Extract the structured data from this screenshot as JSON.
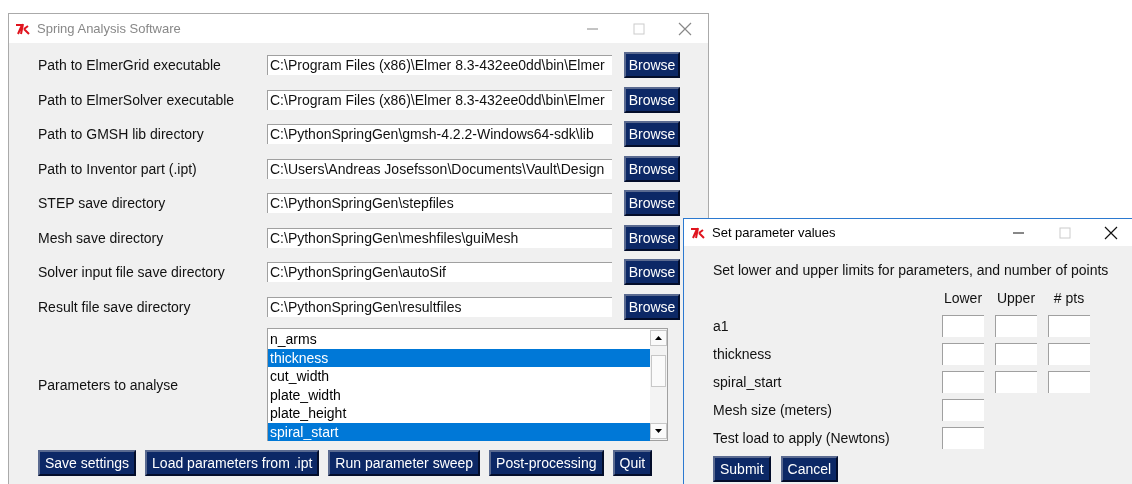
{
  "main_window": {
    "title": "Spring Analysis Software",
    "paths": [
      {
        "label": "Path to ElmerGrid executable",
        "value": "C:\\Program Files (x86)\\Elmer 8.3-432ee0dd\\bin\\Elmer",
        "button": "Browse"
      },
      {
        "label": "Path to ElmerSolver executable",
        "value": "C:\\Program Files (x86)\\Elmer 8.3-432ee0dd\\bin\\Elmer",
        "button": "Browse"
      },
      {
        "label": "Path to GMSH lib directory",
        "value": "C:\\PythonSpringGen\\gmsh-4.2.2-Windows64-sdk\\lib",
        "button": "Browse"
      },
      {
        "label": "Path to Inventor part (.ipt)",
        "value": "C:\\Users\\Andreas Josefsson\\Documents\\Vault\\Design",
        "button": "Browse"
      },
      {
        "label": "STEP save directory",
        "value": "C:\\PythonSpringGen\\stepfiles",
        "button": "Browse"
      },
      {
        "label": "Mesh save directory",
        "value": "C:\\PythonSpringGen\\meshfiles\\guiMesh",
        "button": "Browse"
      },
      {
        "label": "Solver input file save directory",
        "value": "C:\\PythonSpringGen\\autoSif",
        "button": "Browse"
      },
      {
        "label": "Result file save directory",
        "value": "C:\\PythonSpringGen\\resultfiles",
        "button": "Browse"
      }
    ],
    "parameters": {
      "label": "Parameters to analyse",
      "items": [
        {
          "label": "n_arms",
          "selected": false
        },
        {
          "label": "thickness",
          "selected": true
        },
        {
          "label": "cut_width",
          "selected": false
        },
        {
          "label": "plate_width",
          "selected": false
        },
        {
          "label": "plate_height",
          "selected": false
        },
        {
          "label": "spiral_start",
          "selected": true
        }
      ]
    },
    "buttons": [
      "Save settings",
      "Load parameters from .ipt",
      "Run parameter sweep",
      "Post-processing",
      "Quit"
    ]
  },
  "dialog": {
    "title": "Set parameter values",
    "instruction": "Set lower and upper limits for parameters, and number of points",
    "columns": [
      "Lower",
      "Upper",
      "# pts"
    ],
    "rows": [
      {
        "label": "a1",
        "kind": "range"
      },
      {
        "label": "thickness",
        "kind": "range"
      },
      {
        "label": "spiral_start",
        "kind": "range"
      },
      {
        "label": "Mesh size (meters)",
        "kind": "single"
      },
      {
        "label": "Test load to apply (Newtons)",
        "kind": "single"
      }
    ],
    "buttons": [
      "Submit",
      "Cancel"
    ]
  }
}
